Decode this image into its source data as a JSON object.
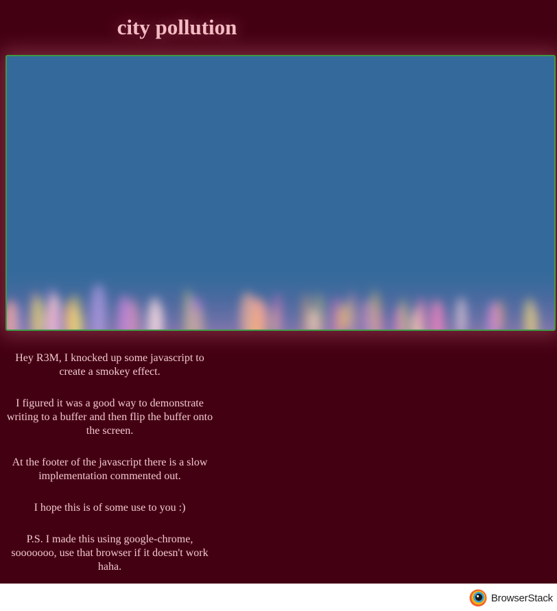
{
  "page": {
    "title": "city pollution",
    "paragraphs": [
      "Hey R3M, I knocked up some javascript to create a smokey effect.",
      "I figured it was a good way to demonstrate writing to a buffer and then flip the buffer onto the screen.",
      "At the footer of the javascript there is a slow implementation commented out.",
      "I hope this is of some use to you :)",
      "P.S. I made this using google-chrome, sooooooo, use that browser if it doesn't work haha."
    ]
  },
  "footer": {
    "brand": "BrowserStack",
    "logo_icon": "browserstack-logo-icon"
  },
  "colors": {
    "background": "#440013",
    "title": "#f4bcc3",
    "canvas_sky": "#336a9b",
    "canvas_border": "#3f9a45",
    "body_text": "#f0c9cd"
  }
}
